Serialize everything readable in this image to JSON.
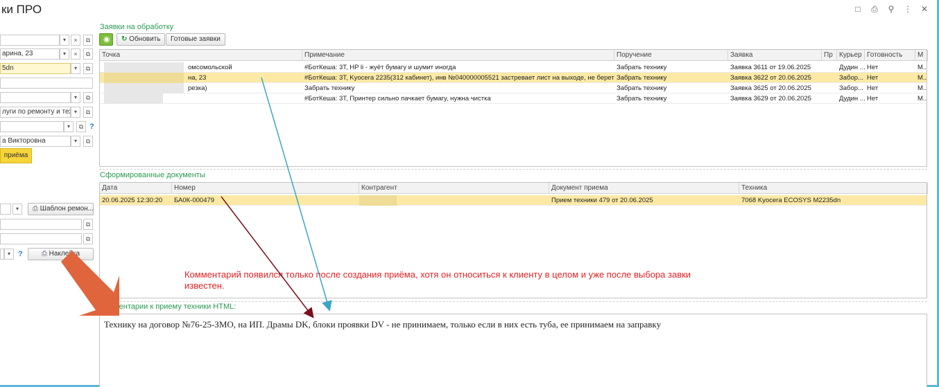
{
  "window": {
    "title": "ки ПРО"
  },
  "left_panel": {
    "field_address": "арина, 23",
    "field_serial": "5dn",
    "field_services": "луги по ремонту и техни",
    "field_person": "а Викторовна",
    "button_accept": "приёма",
    "button_repair_template": "Шаблон ремон...",
    "button_label": "Наклейка",
    "help": "?"
  },
  "requests": {
    "section_title": "Заявки на обработку",
    "button_refresh": "Обновить",
    "button_ready": "Готовые заявки",
    "columns": [
      "Точка",
      "Примечание",
      "Поручение",
      "Заявка",
      "Пр",
      "Курьер",
      "Готовность",
      "М"
    ],
    "rows": [
      {
        "point": "омсомольской",
        "note": "#БотКеша: 3Т, HP li - жуёт бумагу и шумит иногда",
        "task": "Забрать технику",
        "request": "Заявка 3611 от 19.06.2025",
        "pr": "",
        "courier": "Дудин ...",
        "ready": "Нет",
        "m": "М.."
      },
      {
        "point": "на, 23",
        "note": "#БотКеша: 3Т, Kyocera 2235(312 кабинет), инв №040000005521 застревает лист на выходе, не берет лист ...",
        "task": "Забрать технику",
        "request": "Заявка 3622 от 20.06.2025",
        "pr": "",
        "courier": "Забор...",
        "ready": "Нет",
        "m": "М.."
      },
      {
        "point": "резка)",
        "note": "Забрать технику",
        "task": "Забрать технику",
        "request": "Заявка 3625 от 20.06.2025",
        "pr": "",
        "courier": "Забор...",
        "ready": "Нет",
        "m": "М.."
      },
      {
        "point": "",
        "note": "#БотКеша: 3Т, Принтер сильно пачкает бумагу, нужна чистка",
        "task": "Забрать технику",
        "request": "Заявка 3629 от 20.06.2025",
        "pr": "",
        "courier": "Дудин ...",
        "ready": "Нет",
        "m": "М.."
      }
    ]
  },
  "documents": {
    "section_title": "Сформированные документы",
    "columns": [
      "Дата",
      "Номер",
      "Контрагент",
      "Документ приема",
      "Техника"
    ],
    "rows": [
      {
        "date": "20.06.2025 12:30:20",
        "number": "БА0К-000479",
        "counterparty": "",
        "doc": "Прием техники 479 от 20.06.2025",
        "equipment": "7068 Kyocera ECOSYS M2235dn"
      }
    ]
  },
  "annotation": {
    "text": "Комментарий появился только после создания приёма, хотя он относиться к клиенту в целом и уже после выбора завки известен."
  },
  "comments": {
    "section_title": "Комментарии к приему техники HTML:",
    "text": "Технику на договор №76-25-ЗМО, на ИП. Драмы DK, блоки проявки DV - не принимаем, только если в них есть туба, ее принимаем на заправку"
  },
  "colors": {
    "accent_green": "#2a9a52",
    "selection": "#fbe9a5",
    "annotation_red": "#e42222",
    "arrow_teal": "#3aa6c4",
    "arrow_darkred": "#7a0f1a",
    "big_arrow": "#e0643c"
  }
}
